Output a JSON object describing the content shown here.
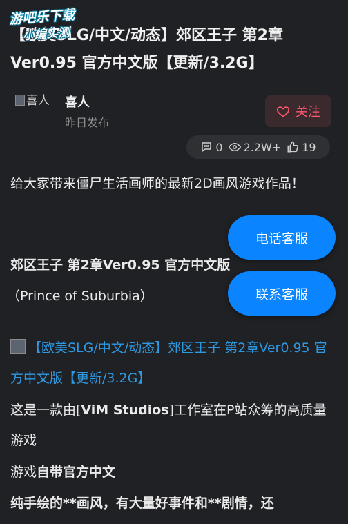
{
  "watermark": {
    "line1": "游吧乐下载",
    "line2": "小编实测"
  },
  "post": {
    "title": "【欧美SLG/中文/动态】郊区王子 第2章Ver0.95 官方中文版【更新/3.2G】",
    "author": {
      "avatar_alt": "喜人",
      "name": "喜人",
      "time": "昨日发布"
    },
    "follow_label": "关注",
    "stats": {
      "comments": "0",
      "views": "2.2W+",
      "likes": "19"
    }
  },
  "body": {
    "intro": "给大家带来僵尸生活画师的最新2D画风游戏作品！",
    "subtitle": "郊区王子 第2章Ver0.95 官方中文版",
    "english": "（Prince of Suburbia）",
    "link_text": "【欧美SLG/中文/动态】郊区王子 第2章Ver0.95 官方中文版【更新/3.2G】",
    "desc_pre": "这是一款由[",
    "desc_studio": "ViM Studios",
    "desc_post": "]工作室在P站众筹的高质量游戏",
    "feature_pre": "游戏",
    "feature_bold": "自带官方中文",
    "last_line": "纯手绘的**画风，有大量好事件和**剧情，还"
  },
  "floating": {
    "phone_label": "电话客服",
    "contact_label": "联系客服"
  },
  "colors": {
    "background": "#202124",
    "accent": "#0a84ff",
    "follow": "#ff5a6e",
    "link": "#2e98e0"
  }
}
